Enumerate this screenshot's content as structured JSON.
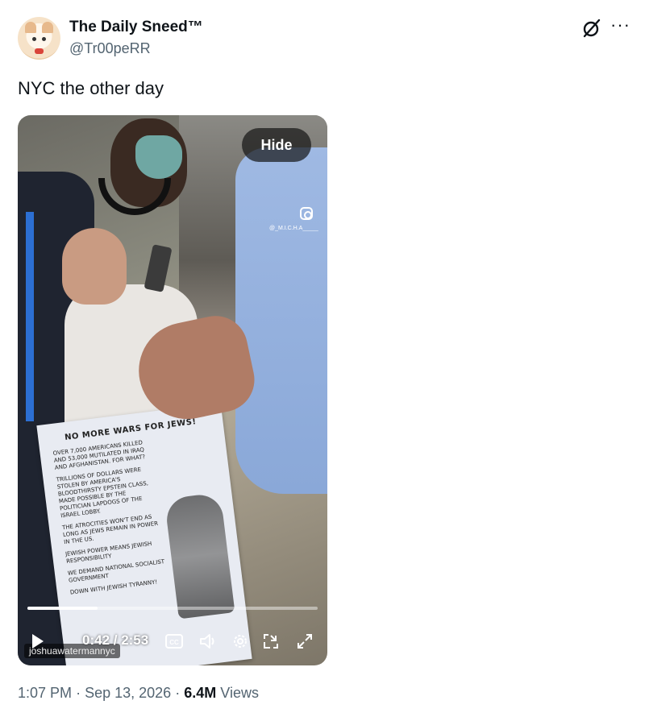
{
  "author": {
    "display_name": "The Daily Sneed™",
    "handle": "@Tr00peRR",
    "avatar_icon": "cat-avatar-icon"
  },
  "header_actions": {
    "grok_icon": "grok-icon",
    "more_icon": "more-dots-icon",
    "more_label": "···"
  },
  "tweet": {
    "text": "NYC the other day"
  },
  "media": {
    "hide_label": "Hide",
    "instagram_icon": "instagram-icon",
    "top_watermark": "@_M.I.C.H.A_____",
    "bottom_watermark": "joshuawatermannyc",
    "flyer": {
      "title": "NO MORE WARS FOR JEWS!",
      "p1": "Over 7,000 Americans killed and 53,000 mutilated in Iraq and Afghanistan. For what?",
      "p2": "Trillions of dollars were stolen by America's bloodthirsty Epstein class, made possible by the politician lapdogs of the Israel lobby.",
      "p3": "The atrocities won't end as long as Jews remain in power in the US.",
      "p4": "Jewish power means Jewish responsibility",
      "p5": "We demand national socialist government",
      "p6": "Down with Jewish tyranny!"
    },
    "player": {
      "current_time": "0:42",
      "duration": "2:53",
      "time_display": "0:42 / 2:53",
      "progress_fraction": 0.243,
      "icons": [
        "play-icon",
        "captions-icon",
        "volume-icon",
        "settings-icon",
        "picture-in-picture-icon",
        "fullscreen-icon"
      ],
      "cc_label": "CC"
    }
  },
  "meta": {
    "time": "1:07 PM",
    "separator": "·",
    "date": "Sep 13, 2026",
    "views_count": "6.4M",
    "views_label": "Views"
  },
  "colors": {
    "text_primary": "#0f1419",
    "text_secondary": "#536471"
  }
}
